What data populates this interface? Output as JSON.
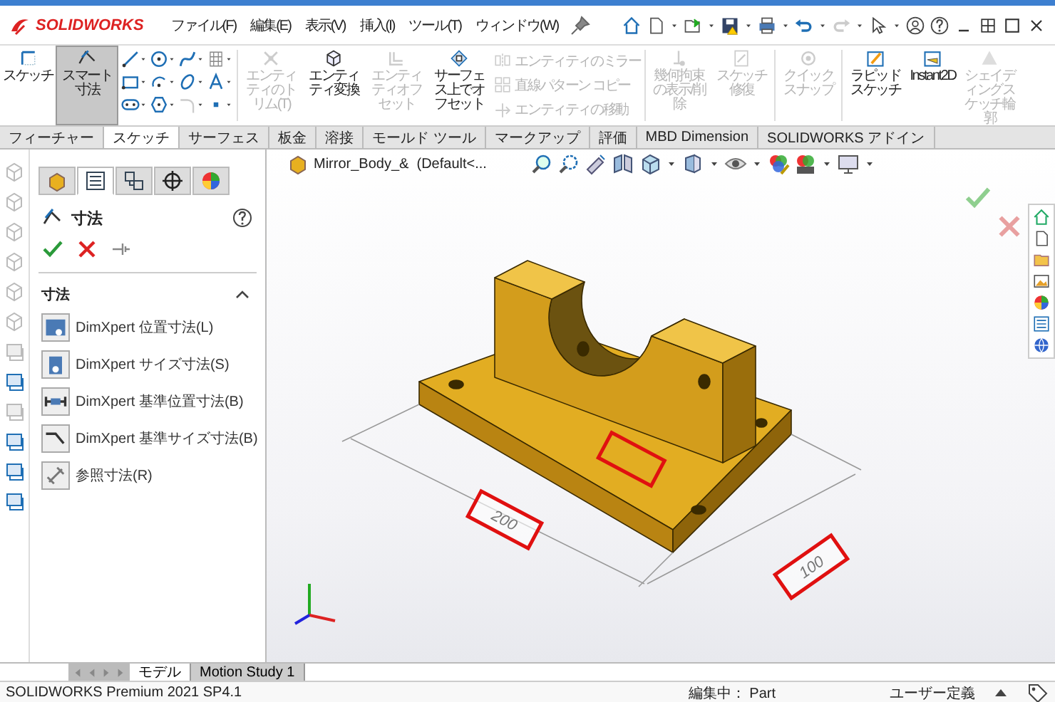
{
  "app": {
    "logo": "SOLIDWORKS"
  },
  "menu": [
    "ファイル(F)",
    "編集(E)",
    "表示(V)",
    "挿入(I)",
    "ツール(T)",
    "ウィンドウ(W)"
  ],
  "ribbon": {
    "left": [
      {
        "label": "スケッチ",
        "selected": false,
        "disabled": false
      },
      {
        "label": "スマート寸法",
        "selected": true,
        "disabled": false
      }
    ],
    "middle": [
      {
        "label": "エンティティのトリム(T)",
        "disabled": true
      },
      {
        "label": "エンティティ変換",
        "disabled": false
      },
      {
        "label": "エンティティオフセット",
        "disabled": true
      },
      {
        "label": "サーフェス上でオフセット",
        "disabled": false
      }
    ],
    "rows": [
      {
        "label": "エンティティのミラー",
        "disabled": true
      },
      {
        "label": "直線パターン コピー",
        "disabled": true
      },
      {
        "label": "エンティティの移動",
        "disabled": true
      }
    ],
    "right": [
      {
        "label": "幾何拘束の表示/削除",
        "disabled": true
      },
      {
        "label": "スケッチ修復",
        "disabled": true
      },
      {
        "label": "クイックスナップ",
        "disabled": true
      },
      {
        "label": "ラピッドスケッチ",
        "disabled": false
      },
      {
        "label": "Instant2D",
        "disabled": false
      },
      {
        "label": "シェイディングスケッチ輪郭",
        "disabled": true
      }
    ]
  },
  "tabs": [
    {
      "label": "フィーチャー",
      "selected": false
    },
    {
      "label": "スケッチ",
      "selected": true
    },
    {
      "label": "サーフェス",
      "selected": false
    },
    {
      "label": "板金",
      "selected": false
    },
    {
      "label": "溶接",
      "selected": false
    },
    {
      "label": "モールド ツール",
      "selected": false
    },
    {
      "label": "マークアップ",
      "selected": false
    },
    {
      "label": "評価",
      "selected": false
    },
    {
      "label": "MBD Dimension",
      "selected": false
    },
    {
      "label": "SOLIDWORKS アドイン",
      "selected": false
    }
  ],
  "panel": {
    "tabs": [
      {
        "selected": false
      },
      {
        "selected": true
      },
      {
        "selected": false
      },
      {
        "selected": false
      },
      {
        "selected": false
      }
    ],
    "title": "寸法",
    "section": "寸法",
    "section_expanded": true,
    "items": [
      "DimXpert 位置寸法(L)",
      "DimXpert サイズ寸法(S)",
      "DimXpert 基準位置寸法(B)",
      "DimXpert 基準サイズ寸法(B)",
      "参照寸法(R)"
    ]
  },
  "viewport": {
    "document": "Mirror_Body_&  (Default<...",
    "dimension_labels": [
      "200",
      "100"
    ]
  },
  "bottom_tabs": [
    {
      "label": "モデル",
      "selected": true
    },
    {
      "label": "Motion Study 1",
      "selected": false
    }
  ],
  "status": {
    "product": "SOLIDWORKS Premium 2021 SP4.1",
    "editing": "編集中： Part",
    "units": "ユーザー定義"
  }
}
